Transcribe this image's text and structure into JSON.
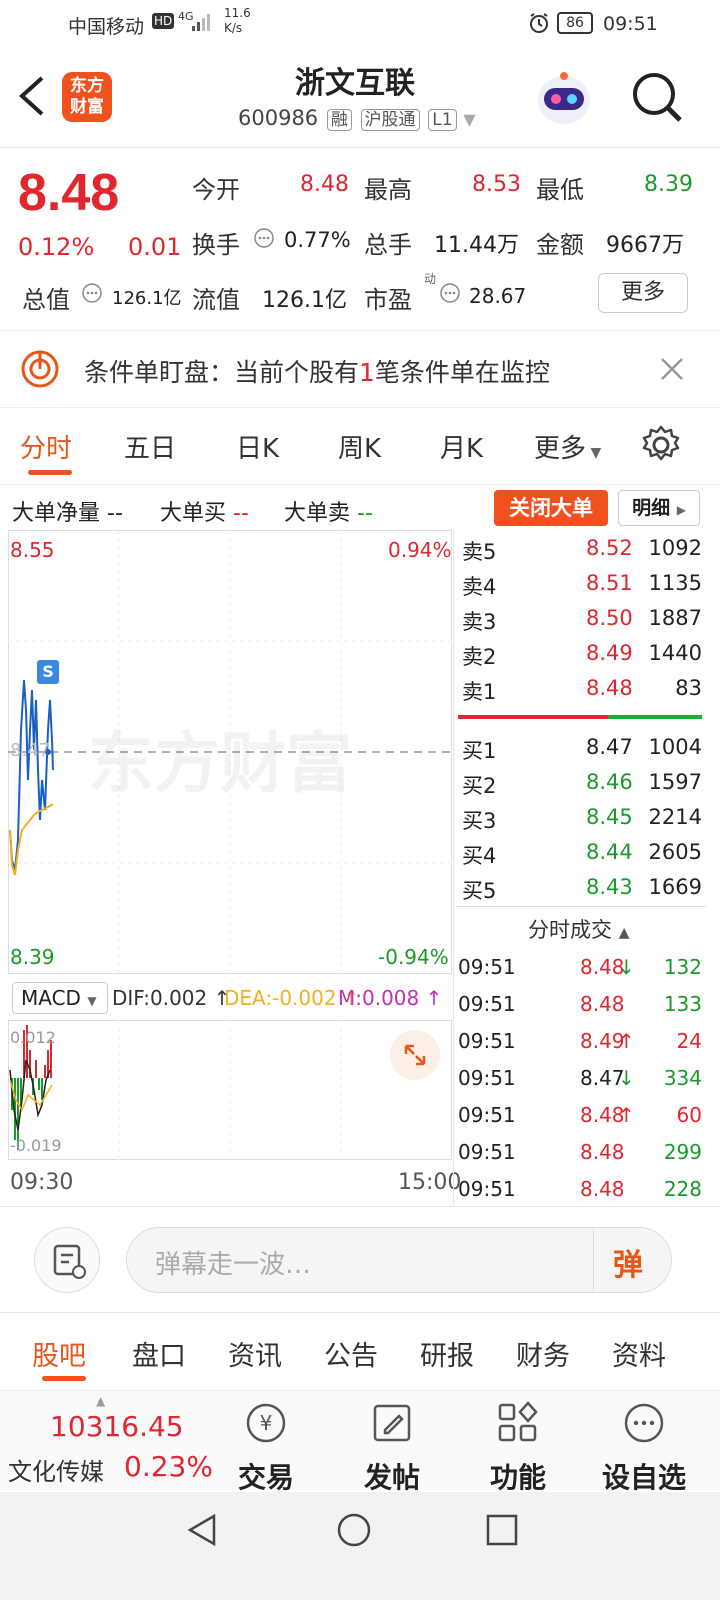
{
  "status_bar": {
    "carrier": "中国移动",
    "hd": "HD",
    "net": "4G",
    "speed_value": "11.6",
    "speed_unit": "K/s",
    "battery": "86",
    "time": "09:51"
  },
  "header": {
    "logo_text_1": "东方",
    "logo_text_2": "财富",
    "stock_name": "浙文互联",
    "stock_code": "600986",
    "tag_margin": "融",
    "tag_hk": "沪股通",
    "tag_level": "L1"
  },
  "quote": {
    "price": "8.48",
    "change_pct": "0.12%",
    "change_amt": "0.01",
    "open_label": "今开",
    "open": "8.48",
    "high_label": "最高",
    "high": "8.53",
    "low_label": "最低",
    "low": "8.39",
    "turnover_label": "换手",
    "turnover": "0.77%",
    "volume_label": "总手",
    "volume": "11.44万",
    "amount_label": "金额",
    "amount": "9667万",
    "mktcap_label": "总值",
    "mktcap": "126.1亿",
    "float_label": "流值",
    "float_cap": "126.1亿",
    "pe_label": "市盈",
    "pe_tag": "动",
    "pe": "28.67",
    "more_label": "更多"
  },
  "alert": {
    "prefix": "条件单盯盘：当前个股有",
    "count": "1",
    "suffix": "笔条件单在监控"
  },
  "chart_tabs": [
    "分时",
    "五日",
    "日K",
    "周K",
    "月K",
    "更多"
  ],
  "bigorder": {
    "net": "大单净量",
    "net_val": "--",
    "buy": "大单买",
    "buy_val": "--",
    "sell": "大单卖",
    "sell_val": "--",
    "close_btn": "关闭大单",
    "detail_btn": "明细"
  },
  "intraday": {
    "y_max": "8.55",
    "pct_max": "0.94%",
    "y_min": "8.39",
    "pct_min": "-0.94%",
    "ref_price": "8.47",
    "watermark": "东方财富",
    "s_marker": "S",
    "time_start": "09:30",
    "time_end": "15:00"
  },
  "macd": {
    "name": "MACD",
    "dif": "DIF:0.002",
    "dea": "DEA:-0.002",
    "m": "M:0.008",
    "top": "0.012",
    "bottom": "-0.019"
  },
  "order_book": {
    "asks": [
      {
        "label": "卖5",
        "price": "8.52",
        "vol": "1092"
      },
      {
        "label": "卖4",
        "price": "8.51",
        "vol": "1135"
      },
      {
        "label": "卖3",
        "price": "8.50",
        "vol": "1887"
      },
      {
        "label": "卖2",
        "price": "8.49",
        "vol": "1440"
      },
      {
        "label": "卖1",
        "price": "8.48",
        "vol": "83"
      }
    ],
    "bids": [
      {
        "label": "买1",
        "price": "8.47",
        "vol": "1004"
      },
      {
        "label": "买2",
        "price": "8.46",
        "vol": "1597"
      },
      {
        "label": "买3",
        "price": "8.45",
        "vol": "2214"
      },
      {
        "label": "买4",
        "price": "8.44",
        "vol": "2605"
      },
      {
        "label": "买5",
        "price": "8.43",
        "vol": "1669"
      }
    ]
  },
  "trades_title": "分时成交",
  "trades": [
    {
      "time": "09:51",
      "price": "8.48",
      "arrow": "↓",
      "vol": "132"
    },
    {
      "time": "09:51",
      "price": "8.48",
      "arrow": "",
      "vol": "133"
    },
    {
      "time": "09:51",
      "price": "8.49",
      "arrow": "↑",
      "vol": "24"
    },
    {
      "time": "09:51",
      "price": "8.47",
      "arrow": "↓",
      "vol": "334"
    },
    {
      "time": "09:51",
      "price": "8.48",
      "arrow": "↑",
      "vol": "60"
    },
    {
      "time": "09:51",
      "price": "8.48",
      "arrow": "",
      "vol": "299"
    },
    {
      "time": "09:51",
      "price": "8.48",
      "arrow": "",
      "vol": "228"
    }
  ],
  "comment": {
    "placeholder": "弹幕走一波…",
    "send": "弹"
  },
  "bottom_tabs": [
    "股吧",
    "盘口",
    "资讯",
    "公告",
    "研报",
    "财务",
    "资料"
  ],
  "index": {
    "value": "10316.45",
    "name": "文化传媒",
    "pct": "0.23%"
  },
  "nav": {
    "trade": "交易",
    "post": "发帖",
    "func": "功能",
    "watch": "设自选"
  }
}
